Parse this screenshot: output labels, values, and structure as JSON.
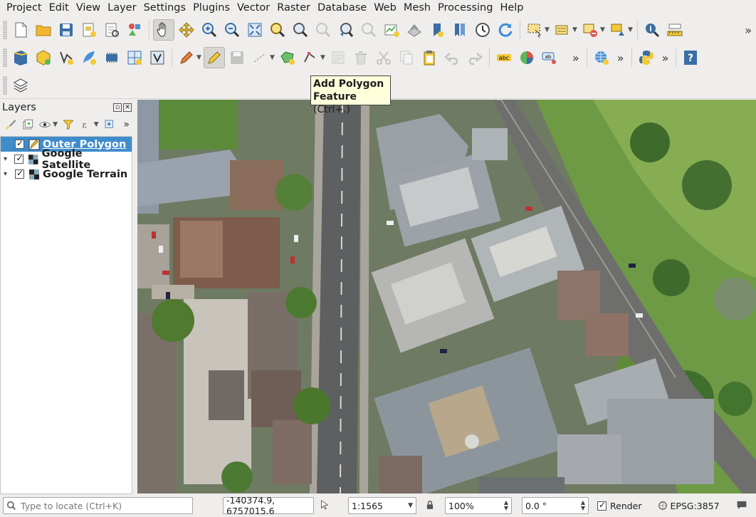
{
  "menu": [
    {
      "label": "Project"
    },
    {
      "label": "Edit"
    },
    {
      "label": "View"
    },
    {
      "label": "Layer"
    },
    {
      "label": "Settings"
    },
    {
      "label": "Plugins"
    },
    {
      "label": "Vector"
    },
    {
      "label": "Raster"
    },
    {
      "label": "Database"
    },
    {
      "label": "Web"
    },
    {
      "label": "Mesh"
    },
    {
      "label": "Processing"
    },
    {
      "label": "Help"
    }
  ],
  "tooltip": {
    "title": "Add Polygon",
    "title2": "Feature",
    "shortcut": "(Ctrl+.)"
  },
  "layers_panel": {
    "title": "Layers",
    "layers": [
      {
        "name": "Outer Polygon",
        "checked": true,
        "selected": true
      },
      {
        "name": "Google Satellite",
        "checked": true,
        "selected": false
      },
      {
        "name": "Google Terrain",
        "checked": true,
        "selected": false
      }
    ]
  },
  "statusbar": {
    "locator_placeholder": "Type to locate (Ctrl+K)",
    "coordinate": "-140374.9, 6757015.6",
    "scale": "1:1565",
    "magnifier": "100%",
    "rotation": "0.0 °",
    "render_label": "Render",
    "crs": "EPSG:3857"
  },
  "colors": {
    "selection": "#3f8ccc",
    "tooltip_bg": "#ffffdc"
  }
}
